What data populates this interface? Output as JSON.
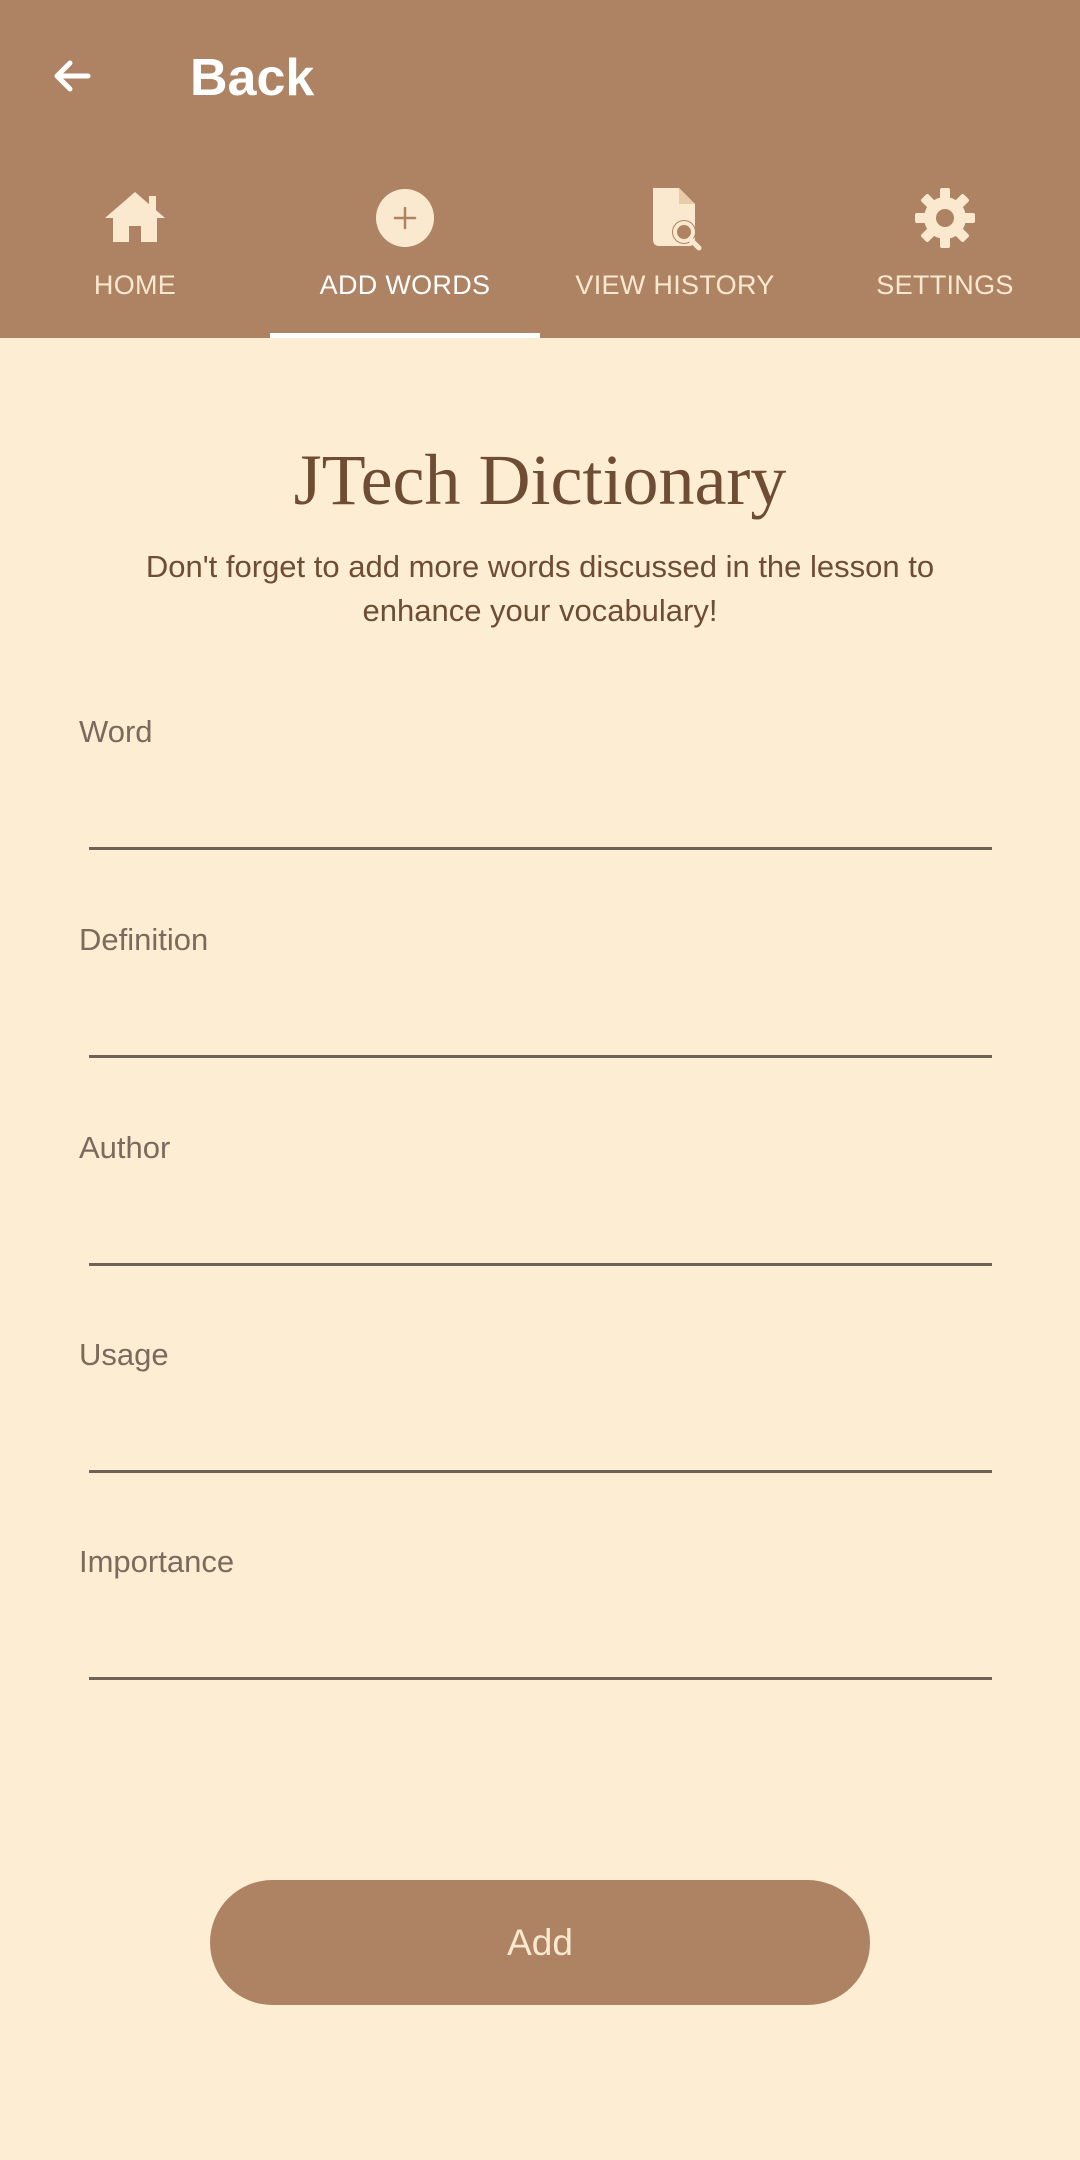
{
  "header": {
    "back_label": "Back"
  },
  "tabs": [
    {
      "label": "HOME",
      "icon": "home-icon",
      "active": false
    },
    {
      "label": "ADD WORDS",
      "icon": "add-circle-icon",
      "active": true
    },
    {
      "label": "VIEW HISTORY",
      "icon": "document-search-icon",
      "active": false
    },
    {
      "label": "SETTINGS",
      "icon": "gear-icon",
      "active": false
    }
  ],
  "main": {
    "title": "JTech Dictionary",
    "subtitle": "Don't forget to add more words discussed in the lesson to enhance your vocabulary!"
  },
  "form": {
    "fields": [
      {
        "label": "Word",
        "value": ""
      },
      {
        "label": "Definition",
        "value": ""
      },
      {
        "label": "Author",
        "value": ""
      },
      {
        "label": "Usage",
        "value": ""
      },
      {
        "label": "Importance",
        "value": ""
      }
    ],
    "submit_label": "Add"
  },
  "colors": {
    "header_bg": "#ae8364",
    "page_bg": "#fdeed3",
    "text_brown": "#6e4d34",
    "tab_icon": "#fbe9cf"
  }
}
